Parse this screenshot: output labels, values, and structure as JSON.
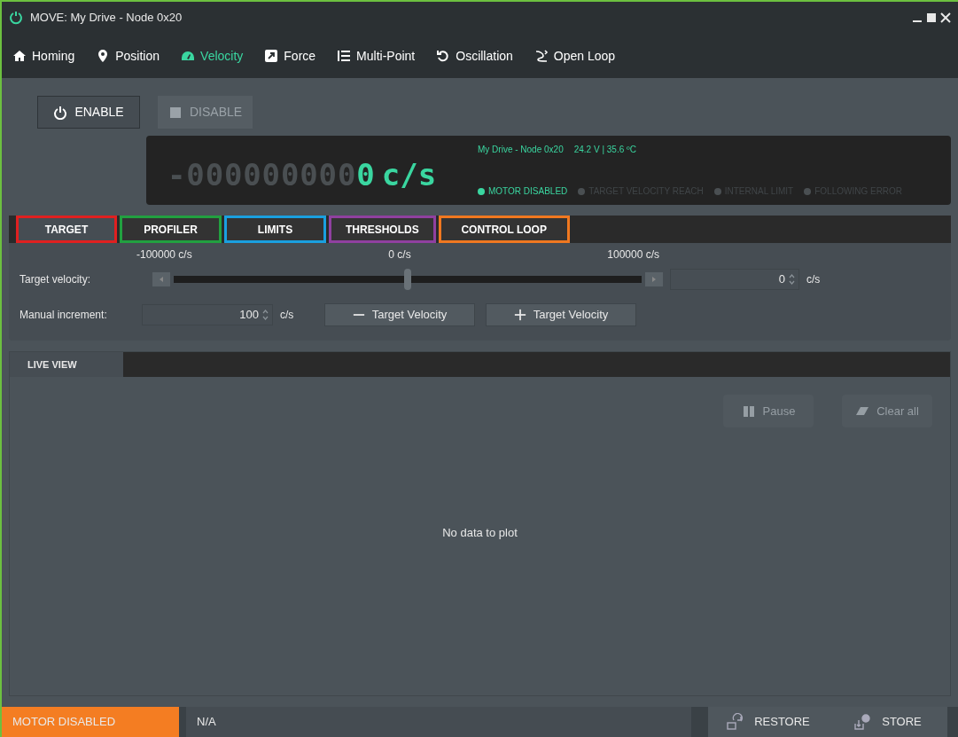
{
  "window": {
    "title": "MOVE: My Drive - Node 0x20"
  },
  "nav": [
    {
      "label": "Homing",
      "selected": false
    },
    {
      "label": "Position",
      "selected": false
    },
    {
      "label": "Velocity",
      "selected": true
    },
    {
      "label": "Force",
      "selected": false
    },
    {
      "label": "Multi-Point",
      "selected": false
    },
    {
      "label": "Oscillation",
      "selected": false
    },
    {
      "label": "Open Loop",
      "selected": false
    }
  ],
  "power_buttons": [
    {
      "label": "ENABLE",
      "disabled": false
    },
    {
      "label": "DISABLE",
      "disabled": true
    }
  ],
  "readout": {
    "leading_digits": "-000000000",
    "value": "0",
    "unit": "c/s",
    "drive_info": "My Drive - Node 0x20",
    "supply": "24.2 V | 35.6 ºC"
  },
  "indicators": [
    {
      "label": "MOTOR DISABLED",
      "on": true
    },
    {
      "label": "TARGET VELOCITY REACH",
      "on": false
    },
    {
      "label": "INTERNAL LIMIT",
      "on": false
    },
    {
      "label": "FOLLOWING ERROR",
      "on": false
    }
  ],
  "tabs": [
    {
      "label": "TARGET",
      "selected": true,
      "color": "#e02020"
    },
    {
      "label": "PROFILER",
      "selected": false,
      "color": "#22a040"
    },
    {
      "label": "LIMITS",
      "selected": false,
      "color": "#1aa0e0"
    },
    {
      "label": "THRESHOLDS",
      "selected": false,
      "color": "#9040a0"
    },
    {
      "label": "CONTROL LOOP",
      "selected": false,
      "color": "#f07820"
    }
  ],
  "target_velocity": {
    "label": "Target velocity:",
    "min_label": "-100000 c/s",
    "mid_label": "0 c/s",
    "max_label": "100000 c/s",
    "level": 0.5,
    "value": "0",
    "unit": "c/s"
  },
  "manual_increment": {
    "label": "Manual increment:",
    "value": "100",
    "unit": "c/s"
  },
  "velocity_buttons": [
    {
      "label": "Target Velocity",
      "kind": "decrement"
    },
    {
      "label": "Target Velocity",
      "kind": "increment"
    }
  ],
  "live_view": {
    "tab": "LIVE VIEW",
    "buttons": [
      {
        "label": "Pause",
        "disabled": true
      },
      {
        "label": "Clear all",
        "disabled": true
      }
    ],
    "message": "No data to plot"
  },
  "status_bar": {
    "state": "MOTOR DISABLED",
    "message": "N/A",
    "buttons": [
      {
        "label": "RESTORE"
      },
      {
        "label": "STORE"
      }
    ]
  }
}
